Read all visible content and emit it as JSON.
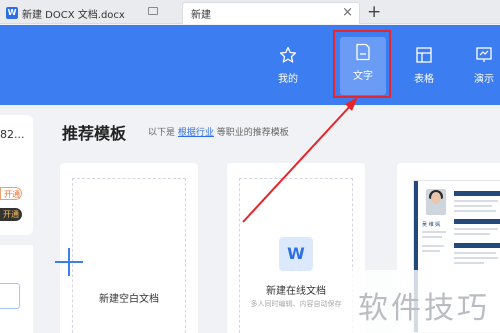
{
  "tabs": [
    {
      "label": "新建 DOCX 文档.docx",
      "badge": "W"
    },
    {
      "label": "新建"
    }
  ],
  "tab_controls": {
    "close": "×",
    "new_tab": "+"
  },
  "nav": [
    {
      "label": "我的",
      "icon": "star-icon"
    },
    {
      "label": "文字",
      "icon": "document-icon"
    },
    {
      "label": "表格",
      "icon": "table-icon"
    },
    {
      "label": "演示",
      "icon": "presentation-icon"
    }
  ],
  "left_panel": {
    "number": "82...",
    "pill1": "开通",
    "pill2": "开通"
  },
  "section": {
    "title": "推荐模板",
    "subtitle_prefix": "以下是",
    "subtitle_link": "根据行业",
    "subtitle_suffix": "等职业的推荐模板"
  },
  "cards": {
    "blank_label": "新建空白文档",
    "online_label": "新建在线文档",
    "online_sub": "多人同时编辑、内容自动保存",
    "online_icon": "W",
    "resume_name": "吴 维 嫣"
  },
  "watermark": "软件技巧",
  "colors": {
    "header": "#3d7df2",
    "highlight": "#e5262d",
    "link": "#2f6fe4"
  }
}
